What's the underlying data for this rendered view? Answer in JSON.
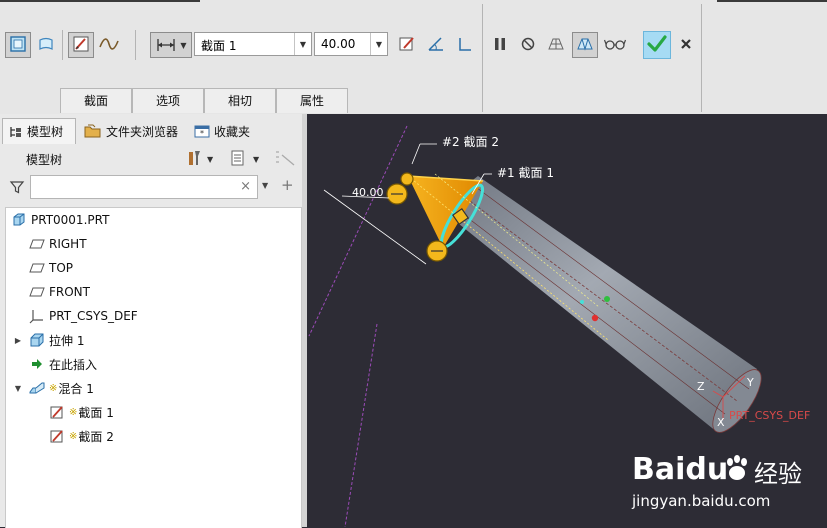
{
  "dashboard": {
    "section_dropdown": {
      "value": "截面 1"
    },
    "depth_dropdown": {
      "value": "40.00"
    },
    "tabs": [
      {
        "label": "截面"
      },
      {
        "label": "选项"
      },
      {
        "label": "相切"
      },
      {
        "label": "属性"
      }
    ],
    "icons": {
      "solid": "solid-icon",
      "surface": "surface-icon",
      "sketch": "sketch-icon",
      "smooth": "smooth-curve-icon",
      "depth": "blind-depth-icon",
      "edit_sketch": "edit-sketch-icon",
      "angle": "angle-icon",
      "insert": "insert-section-icon",
      "pause": "pause-icon",
      "no_preview": "no-preview-icon",
      "mesh": "mesh-preview-icon",
      "verify": "verify-preview-icon",
      "glasses": "glasses-icon",
      "ok": "checkmark-icon",
      "cancel": "close-icon"
    },
    "colors": {
      "ok": "#27a844",
      "ok_bg": "#a6dbf4"
    }
  },
  "navigator": {
    "tabs": [
      {
        "label": "模型树"
      },
      {
        "label": "文件夹浏览器"
      },
      {
        "label": "收藏夹"
      }
    ],
    "tree_title": "模型树",
    "search": {
      "value": ""
    },
    "items": [
      {
        "label": "PRT0001.PRT",
        "icon": "part-icon"
      },
      {
        "label": "RIGHT",
        "icon": "datum-plane-icon"
      },
      {
        "label": "TOP",
        "icon": "datum-plane-icon"
      },
      {
        "label": "FRONT",
        "icon": "datum-plane-icon"
      },
      {
        "label": "PRT_CSYS_DEF",
        "icon": "csys-icon"
      },
      {
        "label": "拉伸 1",
        "icon": "extrude-icon"
      },
      {
        "label": "在此插入",
        "icon": "insert-here-arrow-icon"
      },
      {
        "label": "混合 1",
        "icon": "blend-icon"
      },
      {
        "label": "截面 1",
        "icon": "sketch-section-icon"
      },
      {
        "label": "截面 2",
        "icon": "sketch-section-icon"
      }
    ]
  },
  "graphics": {
    "annotations": {
      "section2": "#2 截面 2",
      "section1": "#1 截面 1",
      "dimension": "40.00",
      "csys": "PRT_CSYS_DEF",
      "z_axis": "Z",
      "y_axis": "Y",
      "x_axis": "X"
    },
    "colors": {
      "background": "#2d2c35",
      "cone": "#f0a010",
      "cylinder": "#8d939d",
      "section_edge": "#46e0d8"
    },
    "watermark": {
      "brand": "Baidu",
      "product": "经验",
      "url": "jingyan.baidu.com"
    }
  }
}
